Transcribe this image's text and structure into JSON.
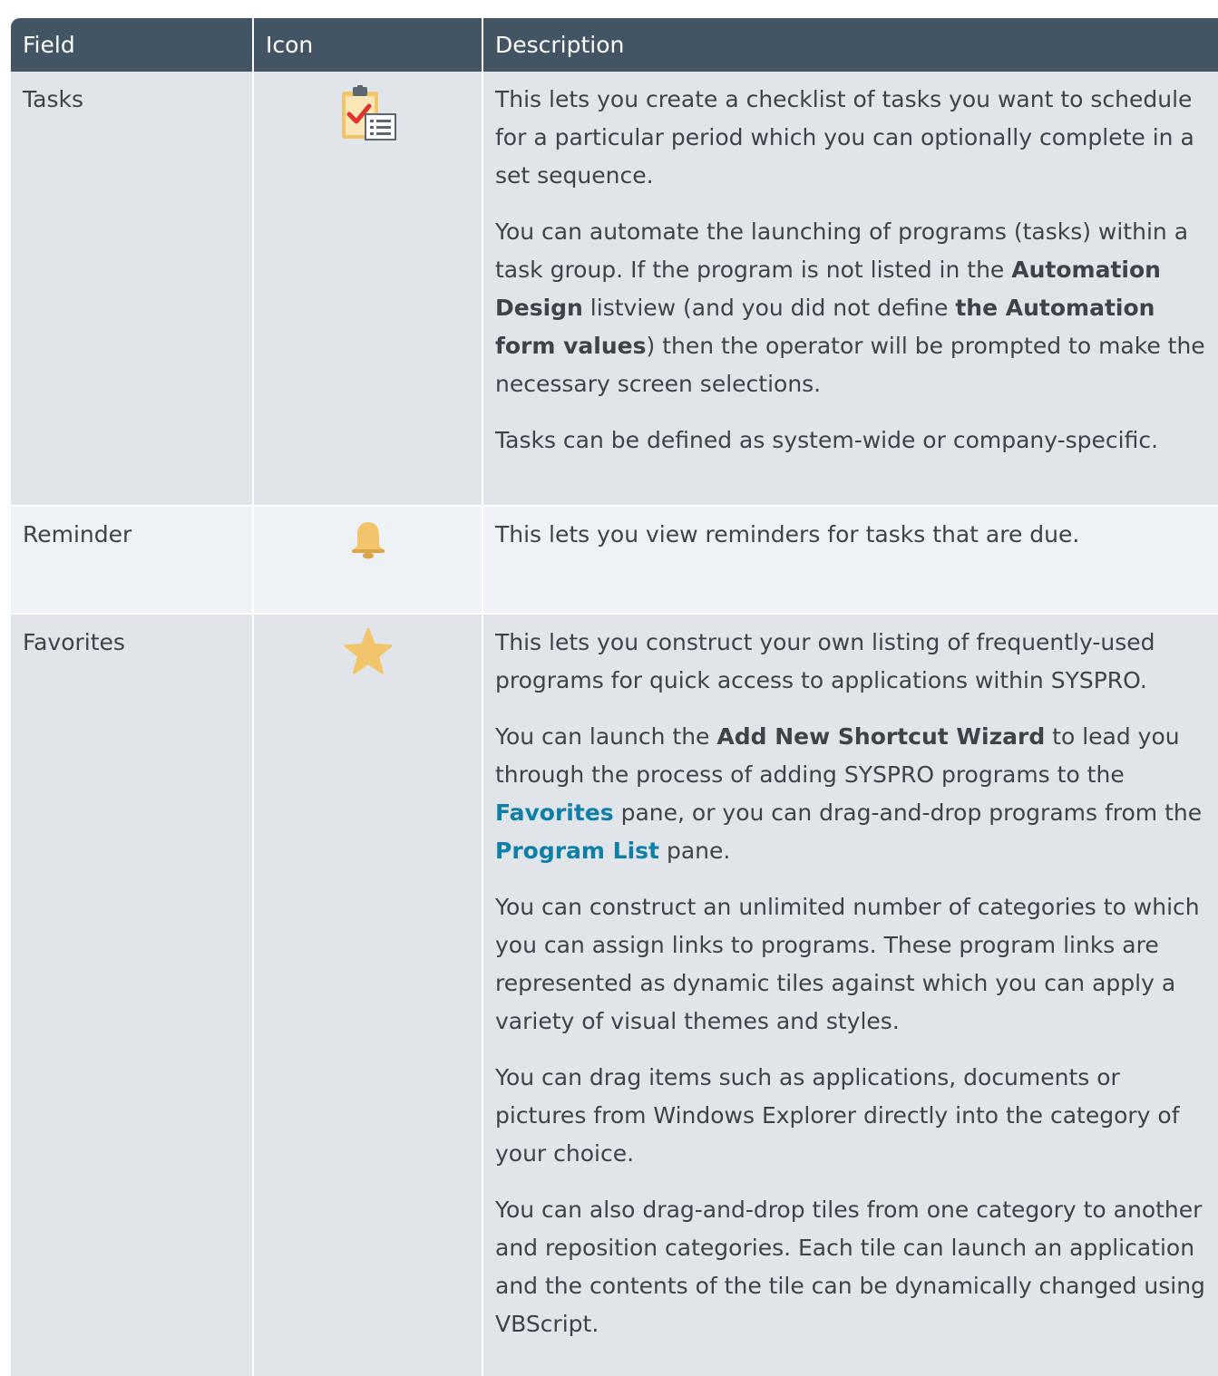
{
  "header": {
    "field": "Field",
    "icon": "Icon",
    "description": "Description"
  },
  "rows": {
    "tasks": {
      "field": "Tasks",
      "icon": "tasks-clipboard-icon",
      "p1": "This lets you create a checklist of tasks you want to schedule for a particular period which you can optionally complete in a set sequence.",
      "p2_a": "You can automate the launching of programs (tasks) within a task group. If the program is not listed in the ",
      "p2_b": "Automation Design",
      "p2_c": " listview (and you did not define ",
      "p2_d": "the Automation form values",
      "p2_e": ") then the operator will be prompted to make the necessary screen selections.",
      "p3": "Tasks can be defined as system-wide or company-specific."
    },
    "reminder": {
      "field": "Reminder",
      "icon": "bell-icon",
      "p1": "This lets you view reminders for tasks that are due."
    },
    "favorites": {
      "field": "Favorites",
      "icon": "star-icon",
      "p1": "This lets you construct your own listing of frequently-used programs for quick access to applications within SYSPRO.",
      "p2_a": "You can launch the ",
      "p2_b": "Add New Shortcut Wizard",
      "p2_c": " to lead you through the process of adding SYSPRO programs to the ",
      "p2_d": "Favorites",
      "p2_e": " pane, or you can drag-and-drop programs from the ",
      "p2_f": "Program List",
      "p2_g": " pane.",
      "p3": "You can construct an unlimited number of categories to which you can assign links to programs. These program links are represented as dynamic tiles against which you can apply a variety of visual themes and styles.",
      "p4": "You can drag items such as applications, documents or pictures from Windows Explorer directly into the category of your choice.",
      "p5": "You can also drag-and-drop tiles from one category to another and reposition categories. Each tile can launch an application and the contents of the tile can be dynamically changed using VBScript."
    }
  },
  "colors": {
    "header_bg": "#435564",
    "cell_bg": "#e0e5e9",
    "alt_cell_bg": "#eef2f5",
    "link": "#0f7fa8",
    "icon_gold": "#f2c56b"
  }
}
